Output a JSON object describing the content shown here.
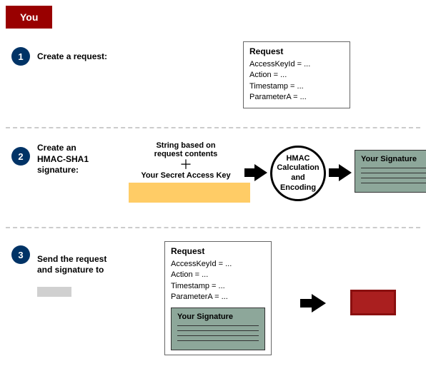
{
  "you_label": "You",
  "steps": {
    "s1": {
      "num": "1",
      "label": "Create a request:"
    },
    "s2": {
      "num": "2",
      "label": "Create an\nHMAC-SHA1\nsignature:"
    },
    "s3": {
      "num": "3",
      "label": "Send the request\nand signature to"
    }
  },
  "request_box": {
    "title": "Request",
    "lines": [
      "AccessKeyId = ...",
      "Action = ...",
      "Timestamp = ...",
      "ParameterA = ..."
    ]
  },
  "hmac_inputs": {
    "top": "String based on\nrequest contents",
    "bottom": "Your Secret Access Key"
  },
  "hmac_circle": "HMAC\nCalculation\nand\nEncoding",
  "signature_title": "Your Signature"
}
